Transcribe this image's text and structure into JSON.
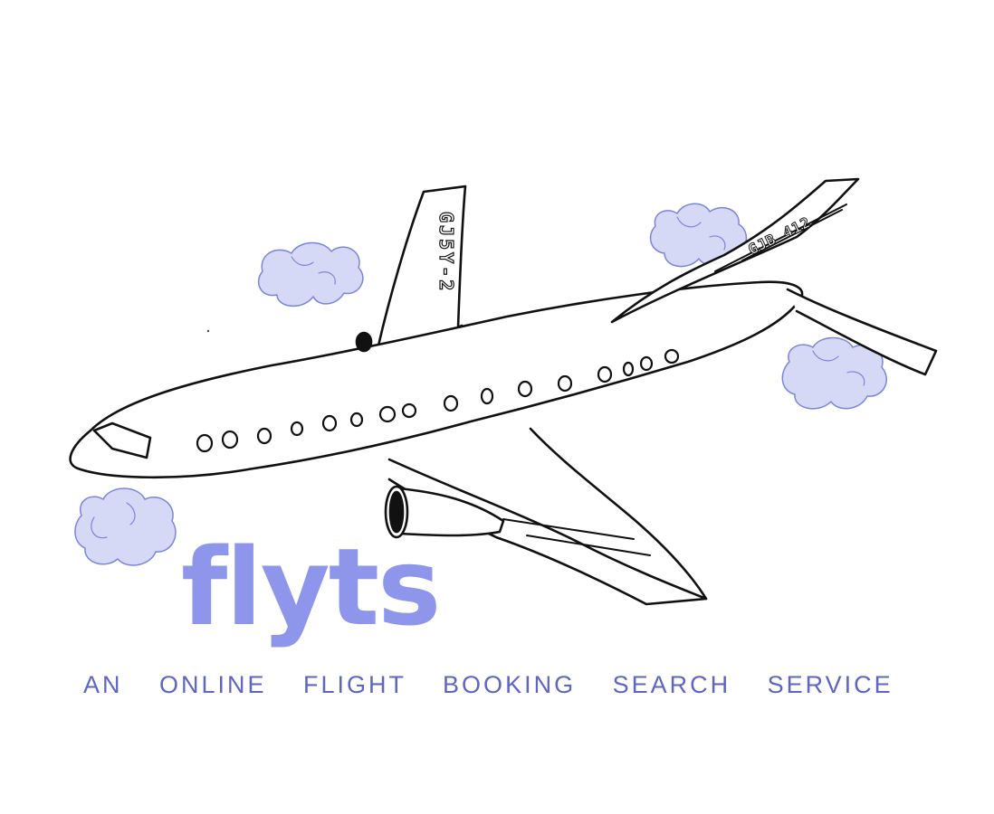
{
  "colors": {
    "cloud_fill": "#d6d9f6",
    "cloud_outline": "#7b84dd",
    "brand": "#8e96ec",
    "tagline": "#5e66c2",
    "ink": "#111111"
  },
  "logo": {
    "name": "flyts",
    "tagline": "AN ONLINE FLIGHT BOOKING SEARCH SERVICE"
  },
  "illustration": {
    "subject": "airplane",
    "fin_text": "GJ5Y-2",
    "stabilizer_text": "GJB 412"
  }
}
